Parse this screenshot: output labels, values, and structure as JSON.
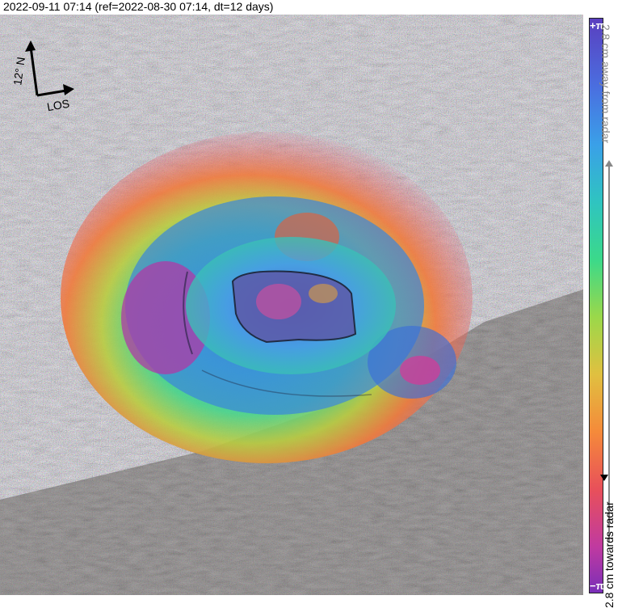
{
  "title": "2022-09-11 07:14 (ref=2022-08-30 07:14, dt=12 days)",
  "compass": {
    "north_label": "12° N",
    "los_label": "LOS"
  },
  "colorbar": {
    "top_symbol": "+π",
    "bottom_symbol": "−π",
    "away_label": "2.8 cm away from radar",
    "towards_label": "2.8 cm towards radar",
    "colors": [
      "#5a3fbf",
      "#4a6fe0",
      "#3aa0e8",
      "#2fc4c0",
      "#3bd98a",
      "#9bd84a",
      "#e0c040",
      "#f58a3a",
      "#e8505a",
      "#c03aa0",
      "#7a2fb8"
    ]
  }
}
